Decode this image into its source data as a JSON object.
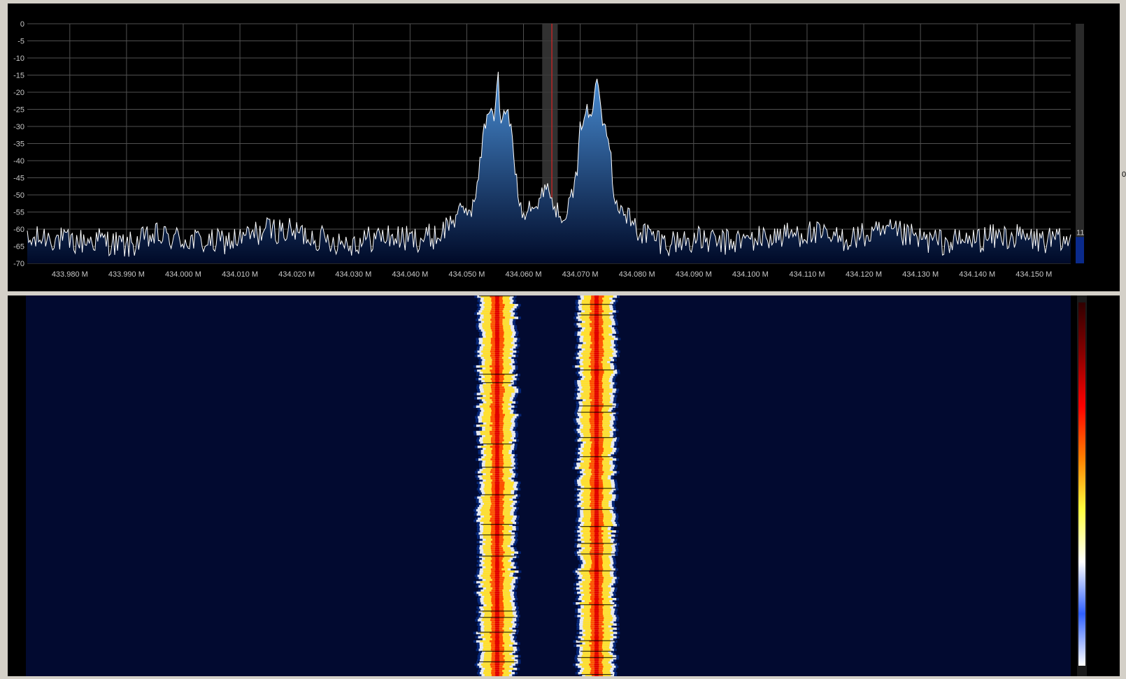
{
  "colors": {
    "background": "#000000",
    "grid": "#505050",
    "trace": "#ffffff",
    "fill_top": "#4a90d8",
    "fill_bottom": "#000a28",
    "filter_band": "#3a3a3a",
    "tuning_line": "#ff2020",
    "waterfall_base": "#020a30",
    "level_bar": "#0a2a8a",
    "window_frame": "#d4d0c8"
  },
  "level_meter": {
    "label": "11",
    "fraction": 0.11
  },
  "edge_glyph": "0",
  "chart_data": {
    "type": "area",
    "title": "",
    "xlabel": "",
    "ylabel": "",
    "x_unit": "M",
    "xlim": [
      433.9725,
      434.1565
    ],
    "ylim": [
      -70,
      0
    ],
    "grid": true,
    "legend": "none",
    "y_ticks": [
      "0",
      "-5",
      "-10",
      "-15",
      "-20",
      "-25",
      "-30",
      "-35",
      "-40",
      "-45",
      "-50",
      "-55",
      "-60",
      "-65",
      "-70"
    ],
    "x_ticks": [
      "433.980 M",
      "433.990 M",
      "434.000 M",
      "434.010 M",
      "434.020 M",
      "434.030 M",
      "434.040 M",
      "434.050 M",
      "434.060 M",
      "434.070 M",
      "434.080 M",
      "434.090 M",
      "434.100 M",
      "434.110 M",
      "434.120 M",
      "434.130 M",
      "434.140 M",
      "434.150 M"
    ],
    "tuned_frequency": 434.065,
    "filter_band": [
      434.0633,
      434.0648
    ],
    "noise_floor": -64,
    "spectrum_points": [
      [
        433.9725,
        -64
      ],
      [
        433.976,
        -62
      ],
      [
        433.98,
        -64
      ],
      [
        433.985,
        -63
      ],
      [
        433.99,
        -65
      ],
      [
        433.995,
        -62
      ],
      [
        434.0,
        -63
      ],
      [
        434.005,
        -64
      ],
      [
        434.01,
        -63
      ],
      [
        434.015,
        -60
      ],
      [
        434.02,
        -61
      ],
      [
        434.025,
        -63
      ],
      [
        434.03,
        -64
      ],
      [
        434.035,
        -62
      ],
      [
        434.04,
        -63
      ],
      [
        434.045,
        -62
      ],
      [
        434.0485,
        -55
      ],
      [
        434.051,
        -54
      ],
      [
        434.052,
        -46
      ],
      [
        434.053,
        -31
      ],
      [
        434.054,
        -24
      ],
      [
        434.055,
        -27
      ],
      [
        434.0555,
        -13
      ],
      [
        434.056,
        -31
      ],
      [
        434.057,
        -24
      ],
      [
        434.058,
        -33
      ],
      [
        434.059,
        -50
      ],
      [
        434.06,
        -56
      ],
      [
        434.061,
        -52
      ],
      [
        434.0625,
        -54
      ],
      [
        434.064,
        -46
      ],
      [
        434.0655,
        -54
      ],
      [
        434.067,
        -56
      ],
      [
        434.068,
        -53
      ],
      [
        434.0695,
        -44
      ],
      [
        434.07,
        -30
      ],
      [
        434.071,
        -25
      ],
      [
        434.072,
        -28
      ],
      [
        434.073,
        -13
      ],
      [
        434.074,
        -28
      ],
      [
        434.075,
        -32
      ],
      [
        434.076,
        -50
      ],
      [
        434.077,
        -54
      ],
      [
        434.08,
        -60
      ],
      [
        434.085,
        -64
      ],
      [
        434.09,
        -63
      ],
      [
        434.095,
        -64
      ],
      [
        434.1,
        -63
      ],
      [
        434.105,
        -62
      ],
      [
        434.11,
        -61
      ],
      [
        434.115,
        -63
      ],
      [
        434.12,
        -62
      ],
      [
        434.125,
        -61
      ],
      [
        434.13,
        -63
      ],
      [
        434.135,
        -64
      ],
      [
        434.14,
        -63
      ],
      [
        434.145,
        -62
      ],
      [
        434.15,
        -63
      ],
      [
        434.1565,
        -64
      ]
    ],
    "waterfall": {
      "type": "heatmap",
      "signal_bands": [
        {
          "center": 434.0555,
          "width": 0.003
        },
        {
          "center": 434.073,
          "width": 0.003
        }
      ],
      "colorbar": [
        "#ffffff",
        "#3060ff",
        "#ffffff",
        "#ffff40",
        "#ff8000",
        "#ff0000",
        "#8a0000",
        "#300000"
      ]
    }
  }
}
